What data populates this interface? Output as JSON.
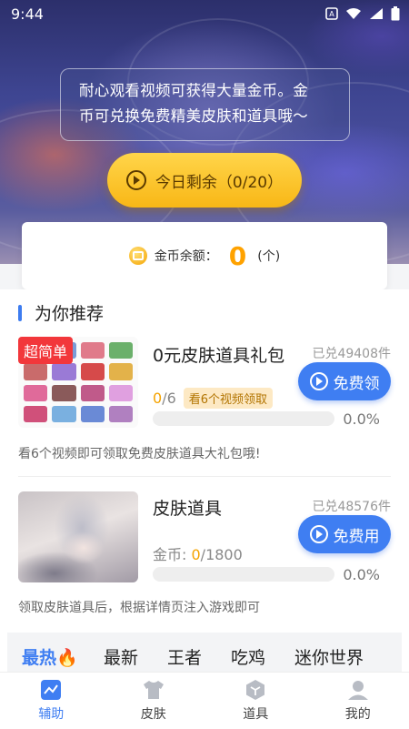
{
  "status_bar": {
    "time": "9:44",
    "icons": [
      "notification-icon",
      "wifi-icon",
      "signal-icon",
      "battery-icon"
    ]
  },
  "hero": {
    "notice_line1": "耐心观看视频可获得大量金币。金",
    "notice_line2": "币可兑换免费精美皮肤和道具哦～",
    "today_button": "今日剩余（0/20）"
  },
  "balance": {
    "label": "金币余额：",
    "value": "0",
    "unit": "(个)"
  },
  "section": {
    "title": "为你推荐"
  },
  "items": [
    {
      "badge": "超简单",
      "title": "0元皮肤道具礼包",
      "redeemed": "已兑49408件",
      "progress_current": "0",
      "progress_total": "/6",
      "tag": "看6个视频领取",
      "button": "免费领",
      "percent_text": "0.0%",
      "percent": 0,
      "desc": "看6个视频即可领取免费皮肤道具大礼包哦!"
    },
    {
      "title": "皮肤道具",
      "redeemed": "已兑48576件",
      "coins_label": "金币: ",
      "progress_current": "0",
      "progress_total": "/1800",
      "button": "免费用",
      "percent_text": "0.0%",
      "percent": 0,
      "desc": "领取皮肤道具后，根据详情页注入游戏即可"
    }
  ],
  "category_tabs": [
    {
      "label": "最热🔥",
      "active": true
    },
    {
      "label": "最新",
      "active": false
    },
    {
      "label": "王者",
      "active": false
    },
    {
      "label": "吃鸡",
      "active": false
    },
    {
      "label": "迷你世界",
      "active": false
    }
  ],
  "bottom_nav": [
    {
      "label": "辅助",
      "icon": "chart-icon",
      "active": true
    },
    {
      "label": "皮肤",
      "icon": "shirt-icon",
      "active": false
    },
    {
      "label": "道具",
      "icon": "cube-icon",
      "active": false
    },
    {
      "label": "我的",
      "icon": "user-icon",
      "active": false
    }
  ],
  "colors": {
    "accent": "#3f7ef2",
    "coin": "#ffa200",
    "badge": "#f2373b",
    "gold_button": "#f8b716"
  }
}
